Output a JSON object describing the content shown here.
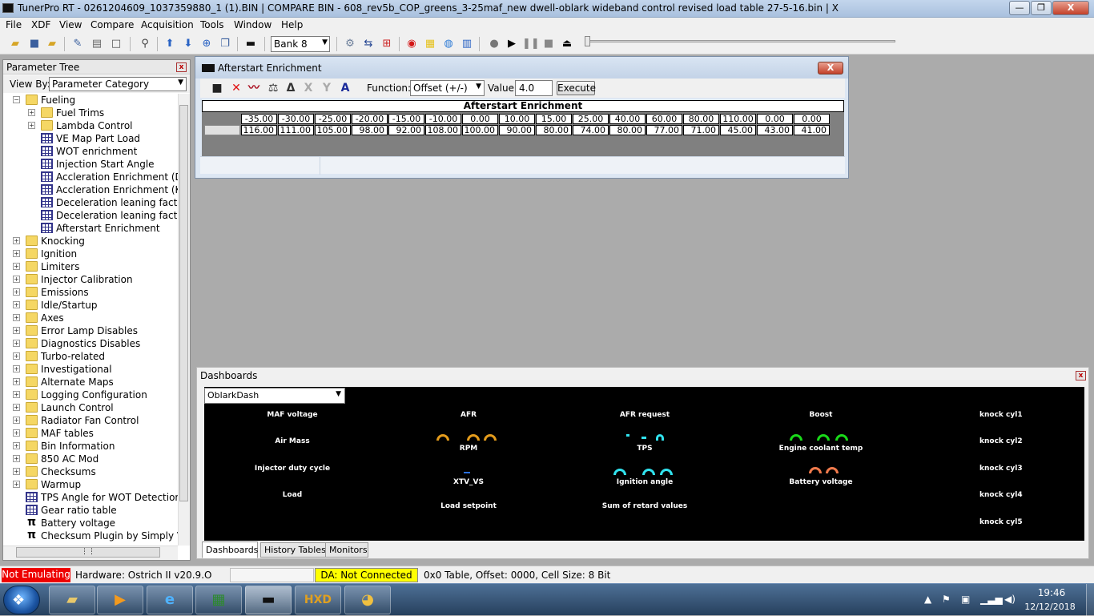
{
  "window": {
    "title": "TunerPro RT - 0261204609_1037359880_1 (1).BIN | COMPARE BIN - 608_rev5b_COP_greens_3-25maf_new dwell-oblark wideband control revised load table 27-5-16.bin | X",
    "min_label": "—",
    "max_label": "❐",
    "close_label": "X"
  },
  "menu": [
    "File",
    "XDF",
    "View",
    "Compare",
    "Acquisition",
    "Tools",
    "Window",
    "Help"
  ],
  "toolbar": {
    "bank_value": "Bank 8",
    "icons": [
      "open-folder-icon",
      "save-icon",
      "folder-save-icon",
      "edit-icon",
      "new-document-icon",
      "probe-icon",
      "upload-arrow-icon",
      "download-arrow-icon",
      "download-circle-icon",
      "copy-icon",
      "chip-icon",
      "gears-icon",
      "swap-arrows-icon",
      "emulator-icon",
      "record-icon",
      "note-icon",
      "globe-icon",
      "bar-chart-icon",
      "stop-circle-icon",
      "play-icon",
      "pause-icon",
      "stop-icon",
      "eject-icon"
    ]
  },
  "param_tree": {
    "title": "Parameter Tree",
    "close_label": "x",
    "viewby_label": "View By:",
    "viewby_value": "Parameter Category",
    "items": [
      {
        "label": "Fueling",
        "icon": "folder-open",
        "expander": "−",
        "level": 0
      },
      {
        "label": "Fuel Trims",
        "icon": "folder",
        "expander": "+",
        "level": 1
      },
      {
        "label": "Lambda Control",
        "icon": "folder",
        "expander": "+",
        "level": 1
      },
      {
        "label": "VE Map Part Load",
        "icon": "table-grid",
        "level": 1
      },
      {
        "label": "WOT enrichment",
        "icon": "table-grid",
        "level": 1
      },
      {
        "label": "Injection Start Angle",
        "icon": "table-grid",
        "level": 1
      },
      {
        "label": "Accleration Enrichment (DK)",
        "icon": "table-grid",
        "level": 1
      },
      {
        "label": "Accleration Enrichment (K+L)",
        "icon": "table-grid",
        "level": 1
      },
      {
        "label": "Deceleration leaning factor (K",
        "icon": "table-grid",
        "level": 1
      },
      {
        "label": "Deceleration leaning factor (Dk",
        "icon": "table-grid",
        "level": 1
      },
      {
        "label": "Afterstart Enrichment",
        "icon": "table-grid",
        "level": 1
      },
      {
        "label": "Knocking",
        "icon": "folder",
        "expander": "+",
        "level": 0
      },
      {
        "label": "Ignition",
        "icon": "folder",
        "expander": "+",
        "level": 0
      },
      {
        "label": "Limiters",
        "icon": "folder",
        "expander": "+",
        "level": 0
      },
      {
        "label": "Injector Calibration",
        "icon": "folder",
        "expander": "+",
        "level": 0
      },
      {
        "label": "Emissions",
        "icon": "folder",
        "expander": "+",
        "level": 0
      },
      {
        "label": "Idle/Startup",
        "icon": "folder",
        "expander": "+",
        "level": 0
      },
      {
        "label": "Axes",
        "icon": "folder",
        "expander": "+",
        "level": 0
      },
      {
        "label": "Error Lamp Disables",
        "icon": "folder",
        "expander": "+",
        "level": 0
      },
      {
        "label": "Diagnostics Disables",
        "icon": "folder",
        "expander": "+",
        "level": 0
      },
      {
        "label": "Turbo-related",
        "icon": "folder",
        "expander": "+",
        "level": 0
      },
      {
        "label": "Investigational",
        "icon": "folder",
        "expander": "+",
        "level": 0
      },
      {
        "label": "Alternate Maps",
        "icon": "folder",
        "expander": "+",
        "level": 0
      },
      {
        "label": "Logging Configuration",
        "icon": "folder",
        "expander": "+",
        "level": 0
      },
      {
        "label": "Launch Control",
        "icon": "folder",
        "expander": "+",
        "level": 0
      },
      {
        "label": "Radiator Fan Control",
        "icon": "folder",
        "expander": "+",
        "level": 0
      },
      {
        "label": "MAF tables",
        "icon": "folder",
        "expander": "+",
        "level": 0
      },
      {
        "label": "Bin Information",
        "icon": "folder",
        "expander": "+",
        "level": 0
      },
      {
        "label": "850 AC Mod",
        "icon": "folder",
        "expander": "+",
        "level": 0
      },
      {
        "label": "Checksums",
        "icon": "folder",
        "expander": "+",
        "level": 0
      },
      {
        "label": "Warmup",
        "icon": "folder",
        "expander": "+",
        "level": 0
      },
      {
        "label": "TPS Angle for WOT Detection",
        "icon": "table-grid",
        "level": 0
      },
      {
        "label": "Gear ratio table",
        "icon": "table-grid",
        "level": 0
      },
      {
        "label": "Battery voltage",
        "icon": "pi",
        "level": 0
      },
      {
        "label": "Checksum Plugin by Simply Volvo",
        "icon": "pi",
        "level": 0
      }
    ]
  },
  "afterstart": {
    "title": "Afterstart Enrichment",
    "close_label": "X",
    "function_label": "Function:",
    "function_value": "Offset (+/-)",
    "value_label": "Value:",
    "value_input": "4.0",
    "execute_label": "Execute",
    "table_title": "Afterstart Enrichment",
    "columns": [
      "-35.00",
      "-30.00",
      "-25.00",
      "-20.00",
      "-15.00",
      "-10.00",
      "0.00",
      "10.00",
      "15.00",
      "25.00",
      "40.00",
      "60.00",
      "80.00",
      "110.00",
      "0.00",
      "0.00"
    ],
    "values": [
      "116.00",
      "111.00",
      "105.00",
      "98.00",
      "92.00",
      "108.00",
      "100.00",
      "90.00",
      "80.00",
      "74.00",
      "80.00",
      "77.00",
      "71.00",
      "45.00",
      "43.00",
      "41.00"
    ]
  },
  "dashboards": {
    "title": "Dashboards",
    "close_label": "x",
    "selected": "OblarkDash",
    "labels": {
      "maf_voltage": "MAF voltage",
      "air_mass": "Air Mass",
      "injector_duty": "Injector duty cycle",
      "load": "Load",
      "afr": "AFR",
      "rpm": "RPM",
      "xtv_vs": "XTV_VS",
      "load_setpoint": "Load setpoint",
      "afr_request": "AFR request",
      "tps": "TPS",
      "ignition_angle": "Ignition angle",
      "sum_retard": "Sum of retard values",
      "boost": "Boost",
      "engine_coolant": "Engine coolant temp",
      "battery_voltage": "Battery voltage",
      "knock1": "knock cyl1",
      "knock2": "knock cyl2",
      "knock3": "knock cyl3",
      "knock4": "knock cyl4",
      "knock5": "knock cyl5"
    },
    "gauge_colors": {
      "orange": "#e39b1c",
      "cyan": "#31e3ef",
      "green": "#19d919",
      "salmon": "#f07a4c"
    },
    "tabs": [
      "Dashboards",
      "History Tables",
      "Monitors"
    ]
  },
  "statusbar": {
    "emulating": "Not Emulating",
    "hardware": "Hardware: Ostrich II v20.9.O",
    "da": "DA: Not Connected",
    "info": "0x0 Table, Offset: 0000,  Cell Size: 8 Bit"
  },
  "taskbar": {
    "apps": [
      "file-explorer-icon",
      "media-player-icon",
      "internet-explorer-icon",
      "spreadsheet-icon",
      "tunerpro-chip-icon",
      "hxd-icon",
      "paint-icon"
    ],
    "hxd_label": "HXD",
    "time": "19:46",
    "date": "12/12/2018"
  }
}
